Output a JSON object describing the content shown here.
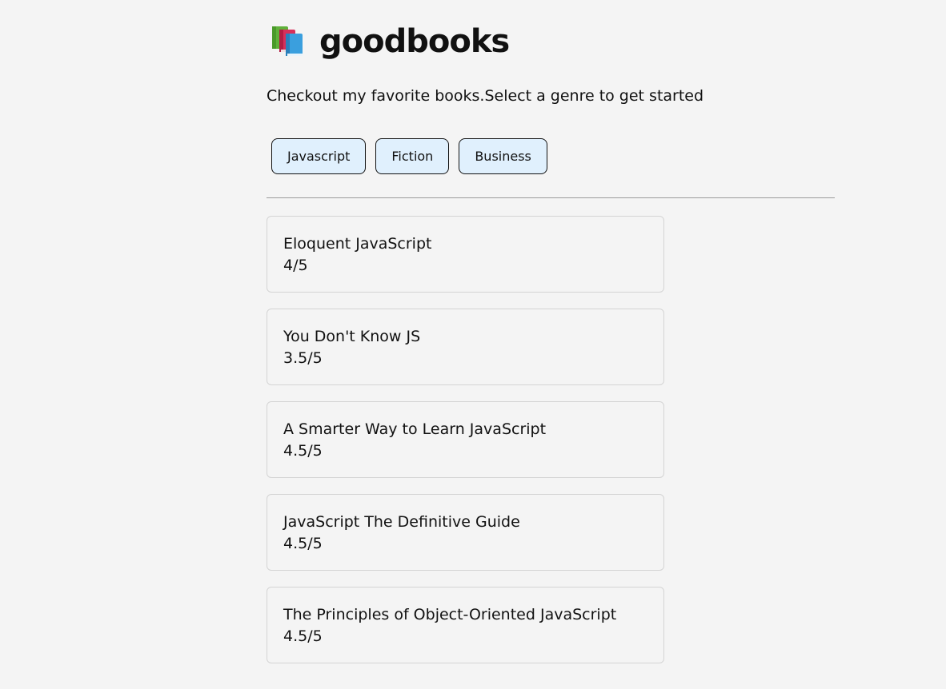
{
  "header": {
    "logo_icon": "books-icon",
    "title": "goodbooks"
  },
  "subtitle": "Checkout my favorite books.Select a genre to get started",
  "genres": [
    {
      "label": "Javascript"
    },
    {
      "label": "Fiction"
    },
    {
      "label": "Business"
    }
  ],
  "books": [
    {
      "name": "Eloquent JavaScript",
      "rating": "4/5"
    },
    {
      "name": "You Don't Know JS",
      "rating": "3.5/5"
    },
    {
      "name": "A Smarter Way to Learn JavaScript",
      "rating": "4.5/5"
    },
    {
      "name": "JavaScript The Definitive Guide",
      "rating": "4.5/5"
    },
    {
      "name": "The Principles of Object-Oriented JavaScript",
      "rating": "4.5/5"
    }
  ],
  "colors": {
    "background": "#f4f4f4",
    "genre_button_bg": "#e0f0fd",
    "card_border": "#d4d4d4"
  }
}
